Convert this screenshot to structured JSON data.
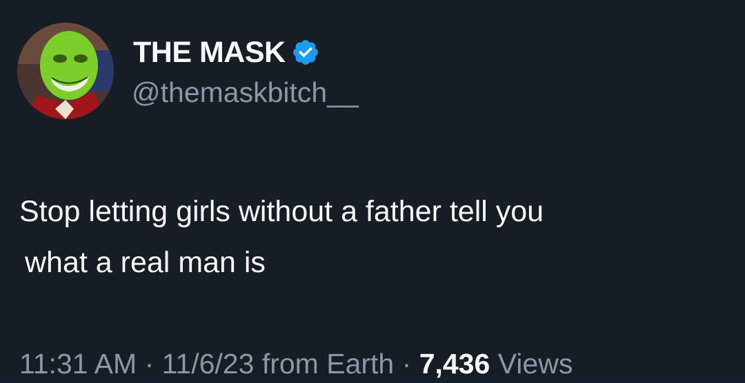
{
  "author": {
    "display_name": "THE MASK",
    "handle": "@themaskbitch__",
    "verified": true,
    "verified_color": "#1d9bf0",
    "avatar_icon": "the-mask-green-face-avatar"
  },
  "tweet": {
    "text_line1": "Stop letting girls without a father tell you",
    "text_line2": "what a real man is"
  },
  "meta": {
    "time": "11:31 AM",
    "separator": "·",
    "date": "11/6/23",
    "source": "from Earth",
    "views_count": "7,436",
    "views_label": "Views"
  },
  "colors": {
    "background": "#161d25",
    "primary_text": "#f7f9f9",
    "secondary_text": "#8b98a5"
  }
}
